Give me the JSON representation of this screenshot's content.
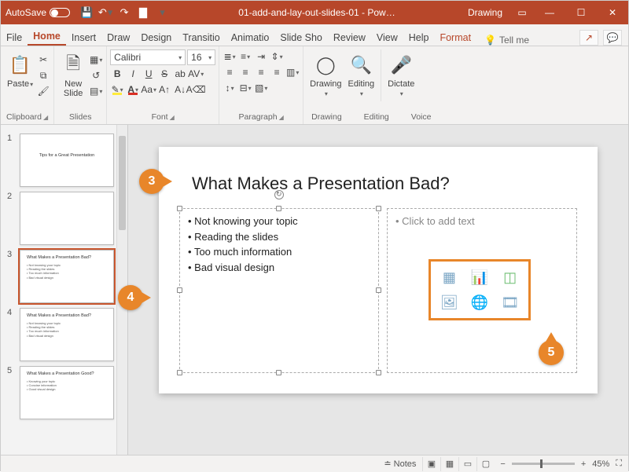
{
  "titlebar": {
    "autosave": "AutoSave",
    "doc_title": "01-add-and-lay-out-slides-01 - Pow…",
    "mode": "Drawing"
  },
  "tabs": {
    "file": "File",
    "home": "Home",
    "insert": "Insert",
    "draw": "Draw",
    "design": "Design",
    "transitions": "Transitio",
    "animations": "Animatio",
    "slideshow": "Slide Sho",
    "review": "Review",
    "view": "View",
    "help": "Help",
    "format": "Format",
    "tellme": "Tell me"
  },
  "ribbon": {
    "clipboard": {
      "label": "Clipboard",
      "paste": "Paste"
    },
    "slides": {
      "label": "Slides",
      "new_slide": "New\nSlide"
    },
    "font": {
      "label": "Font",
      "name": "Calibri",
      "size": "16"
    },
    "paragraph": {
      "label": "Paragraph"
    },
    "drawing": {
      "label": "Drawing",
      "btn": "Drawing"
    },
    "editing": {
      "label": "Editing",
      "btn": "Editing"
    },
    "voice": {
      "label": "Voice",
      "dictate": "Dictate"
    }
  },
  "thumbnails": {
    "items": [
      {
        "num": "1",
        "title": "Tips for a Great Presentation",
        "body": ""
      },
      {
        "num": "2",
        "title": "",
        "body": ""
      },
      {
        "num": "3",
        "title": "What Makes a Presentation Bad?",
        "body": "• Not knowing your topic\n• Reading the slides\n• Too much information\n• Bad visual design"
      },
      {
        "num": "4",
        "title": "What Makes a Presentation Bad?",
        "body": "• Not knowing your topic\n• Reading the slides\n• Too much information\n• Bad visual design"
      },
      {
        "num": "5",
        "title": "What Makes a Presentation Good?",
        "body": "• Knowing your topic\n• Concise information\n• Good visual design"
      }
    ]
  },
  "slide": {
    "title": "What Makes a Presentation Bad?",
    "bullets": [
      "Not knowing your topic",
      "Reading the slides",
      "Too much information",
      "Bad visual design"
    ],
    "placeholder": "Click to add text"
  },
  "callouts": {
    "c3": "3",
    "c4": "4",
    "c5": "5"
  },
  "statusbar": {
    "notes": "Notes",
    "zoom": "45%"
  }
}
